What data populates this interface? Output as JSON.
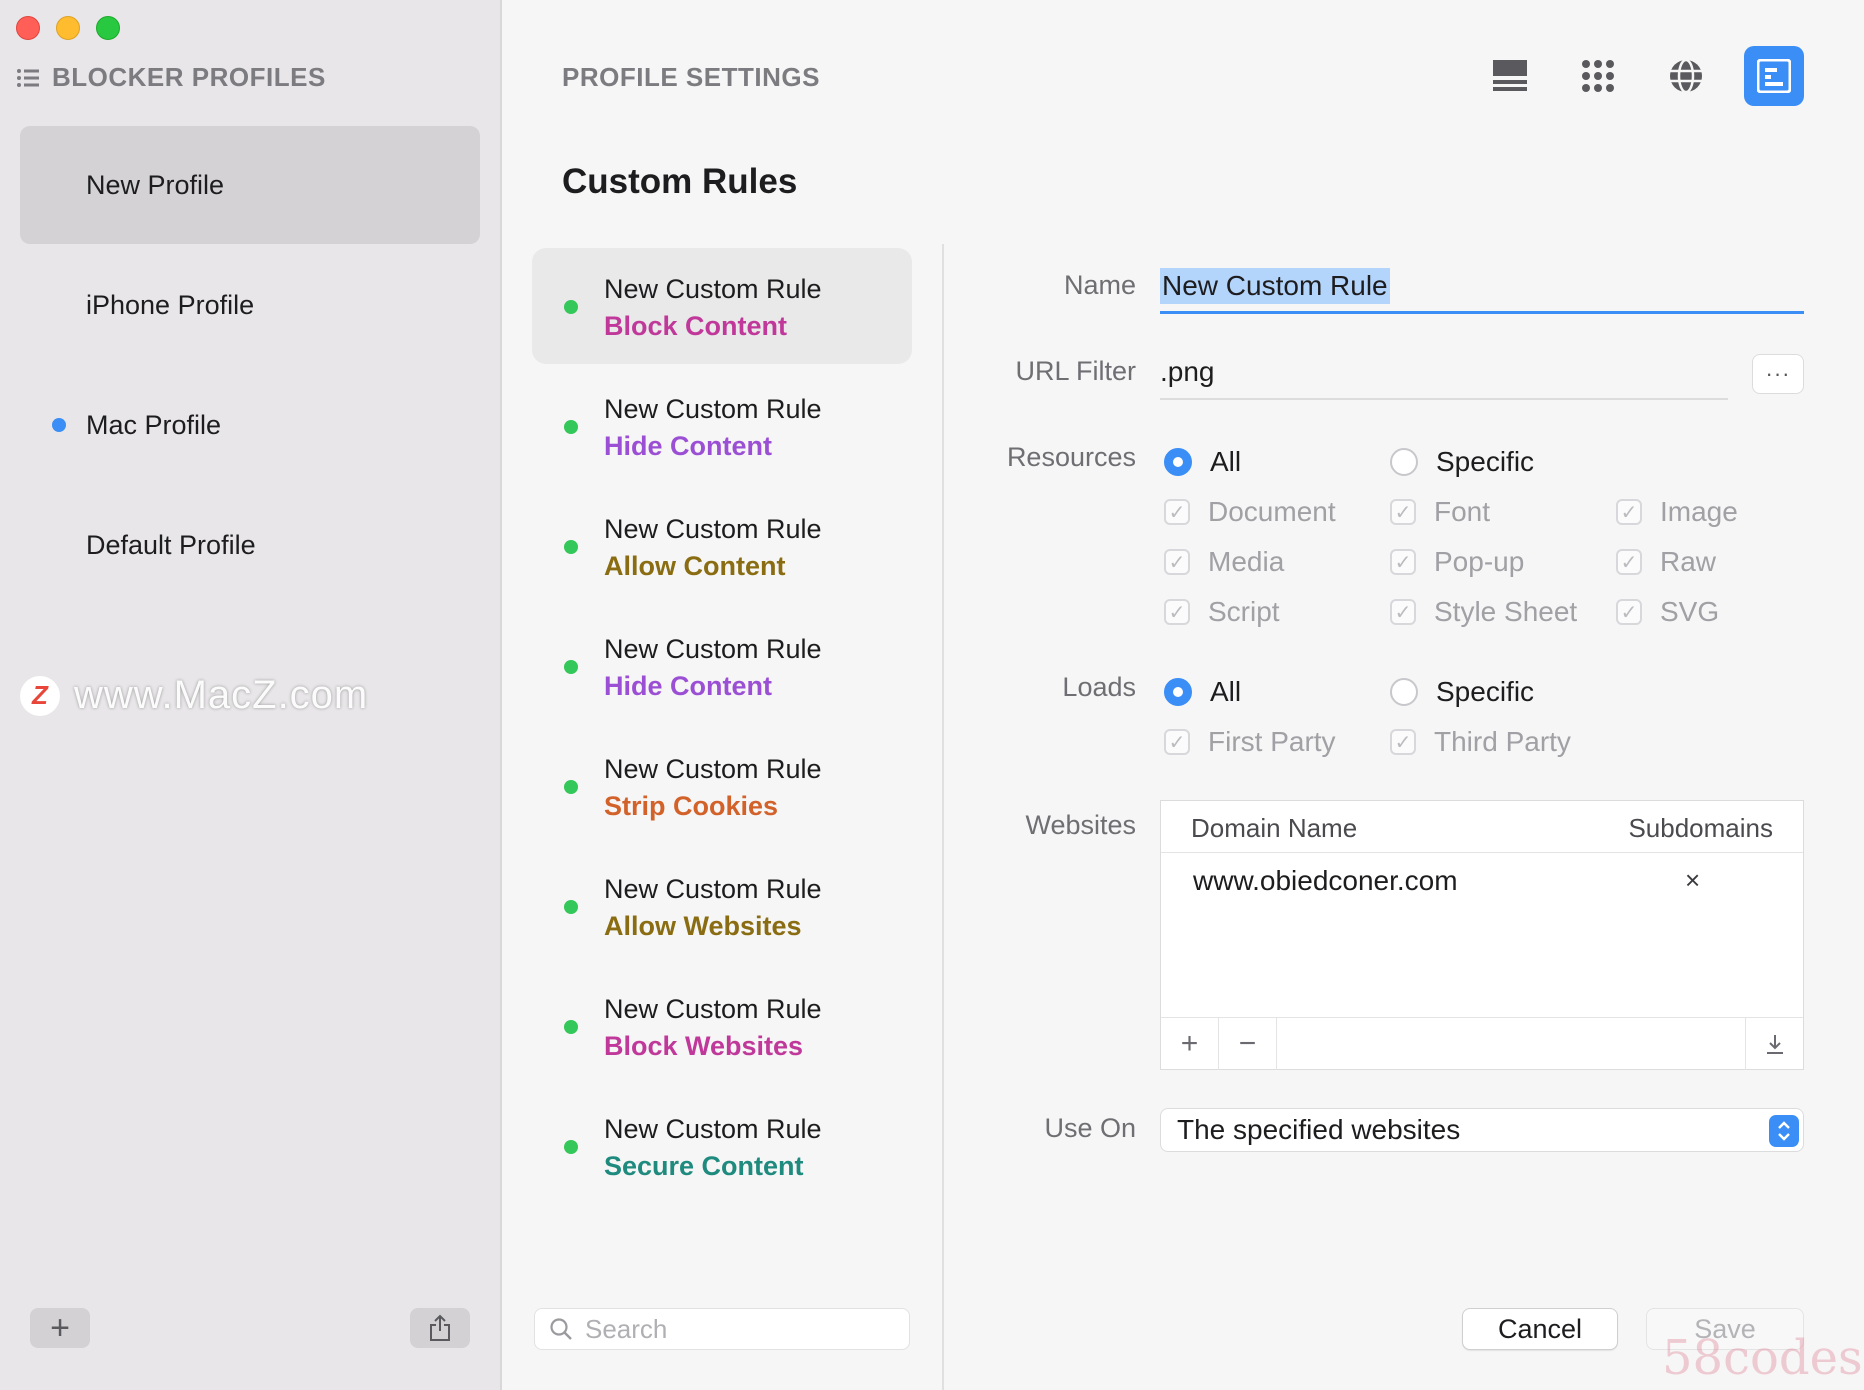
{
  "sidebar": {
    "header": "BLOCKER PROFILES",
    "profiles": [
      {
        "label": "New Profile",
        "selected": true,
        "active": false
      },
      {
        "label": "iPhone Profile",
        "selected": false,
        "active": false
      },
      {
        "label": "Mac Profile",
        "selected": false,
        "active": true
      },
      {
        "label": "Default Profile",
        "selected": false,
        "active": false
      }
    ],
    "add_label": "+",
    "watermark": "www.MacZ.com",
    "watermark_logo": "Z"
  },
  "main": {
    "header": "PROFILE SETTINGS",
    "toolbar": [
      "list-view-icon",
      "grid-view-icon",
      "globe-icon",
      "custom-rules-icon"
    ],
    "section_title": "Custom Rules"
  },
  "rules": [
    {
      "name": "New Custom Rule",
      "type": "Block Content",
      "color": "#c0399a"
    },
    {
      "name": "New Custom Rule",
      "type": "Hide Content",
      "color": "#9b4fd4"
    },
    {
      "name": "New Custom Rule",
      "type": "Allow Content",
      "color": "#8a6d12"
    },
    {
      "name": "New Custom Rule",
      "type": "Hide Content",
      "color": "#9b4fd4"
    },
    {
      "name": "New Custom Rule",
      "type": "Strip Cookies",
      "color": "#d2622a"
    },
    {
      "name": "New Custom Rule",
      "type": "Allow Websites",
      "color": "#8a6d12"
    },
    {
      "name": "New Custom Rule",
      "type": "Block Websites",
      "color": "#c0399a"
    },
    {
      "name": "New Custom Rule",
      "type": "Secure Content",
      "color": "#1f8a7e"
    }
  ],
  "search": {
    "placeholder": "Search"
  },
  "form": {
    "labels": {
      "name": "Name",
      "url_filter": "URL Filter",
      "resources": "Resources",
      "loads": "Loads",
      "websites": "Websites",
      "use_on": "Use On"
    },
    "name_value": "New Custom Rule",
    "url_filter_value": ".png",
    "more_label": "···",
    "resources": {
      "all_label": "All",
      "specific_label": "Specific",
      "items": [
        "Document",
        "Font",
        "Image",
        "Media",
        "Pop-up",
        "Raw",
        "Script",
        "Style Sheet",
        "SVG"
      ]
    },
    "loads": {
      "all_label": "All",
      "specific_label": "Specific",
      "items": [
        "First Party",
        "Third Party"
      ]
    },
    "websites": {
      "col_domain": "Domain Name",
      "col_subdomains": "Subdomains",
      "rows": [
        {
          "domain": "www.obiedconer.com",
          "subdomains": "×"
        }
      ],
      "add": "+",
      "remove": "−"
    },
    "use_on_value": "The specified websites",
    "cancel_label": "Cancel",
    "save_label": "Save"
  },
  "corner_mark": "58codes",
  "colors": {
    "accent": "#3a8ef6",
    "rule_dot": "#34c759"
  }
}
